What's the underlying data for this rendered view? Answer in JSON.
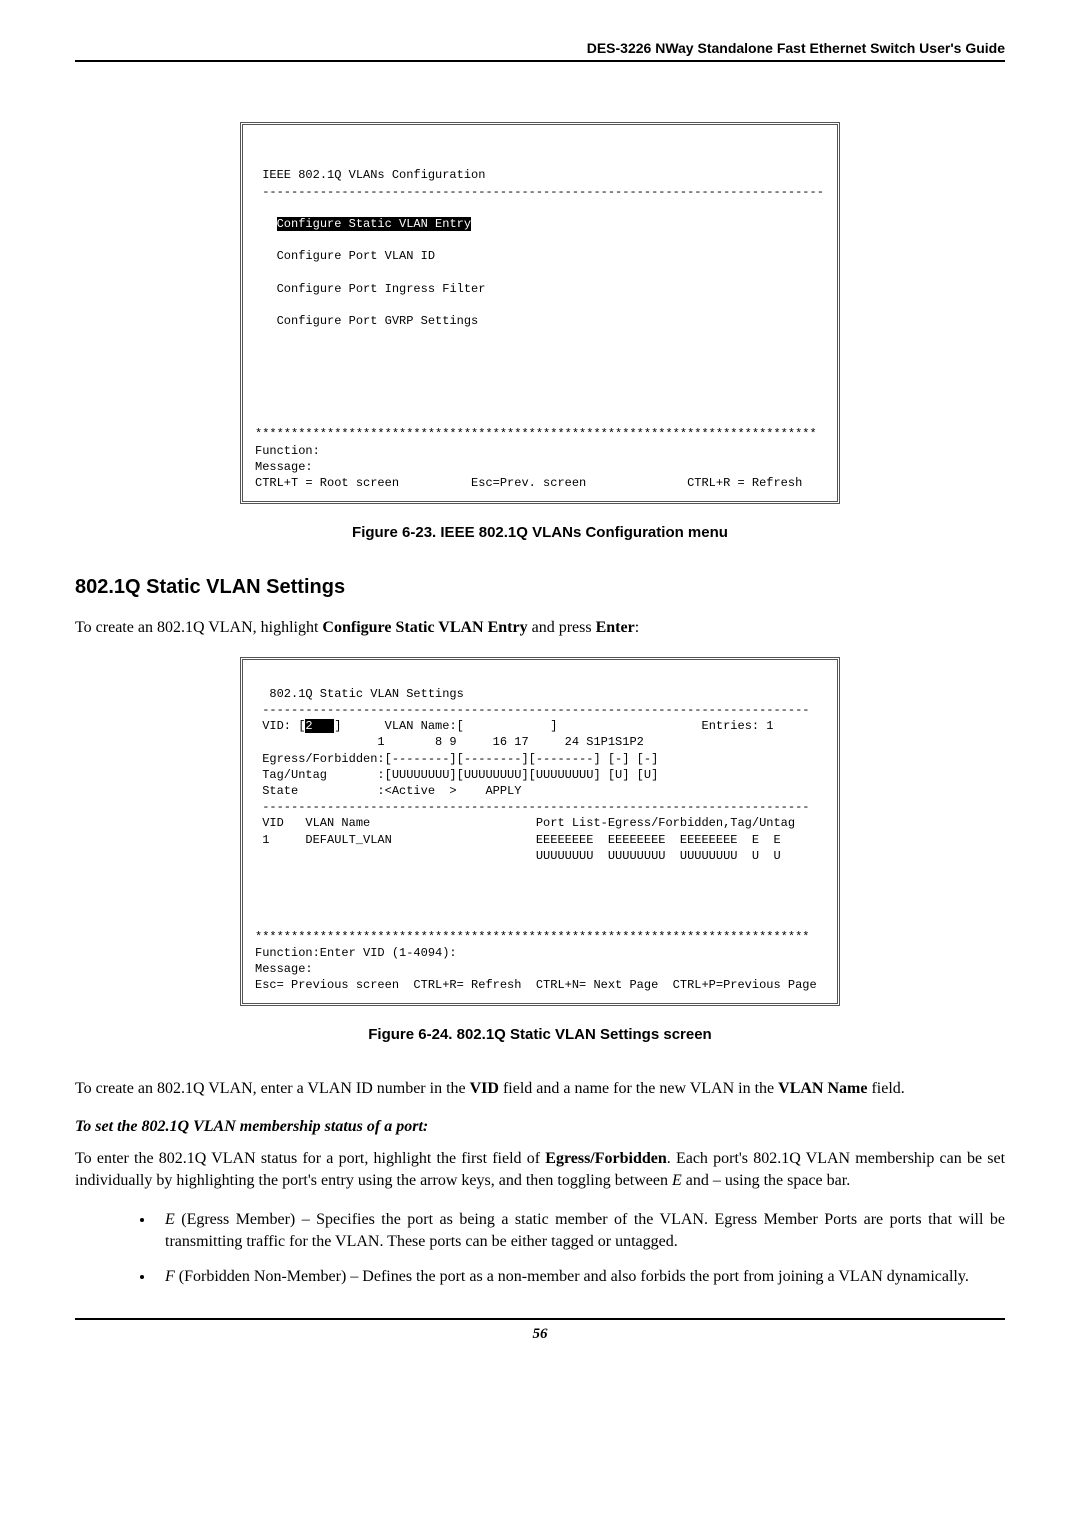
{
  "header": "DES-3226 NWay Standalone Fast Ethernet Switch User's Guide",
  "term1": {
    "title": "IEEE 802.1Q VLANs Configuration",
    "rule": "------------------------------------------------------------------------------",
    "menu_highlight": "Configure Static VLAN Entry",
    "menu2": "Configure Port VLAN ID",
    "menu3": "Configure Port Ingress Filter",
    "menu4": "Configure Port GVRP Settings",
    "stars": "******************************************************************************",
    "func": "Function:",
    "msg": "Message:",
    "footer": "CTRL+T = Root screen          Esc=Prev. screen              CTRL+R = Refresh"
  },
  "cap1": "Figure 6-23.  IEEE 802.1Q VLANs Configuration menu",
  "sect_head": "802.1Q Static VLAN Settings",
  "para1_a": "To create an 802.1Q VLAN, highlight ",
  "para1_b": "Configure Static VLAN Entry",
  "para1_c": " and press ",
  "para1_d": "Enter",
  "para1_e": ":",
  "term2": {
    "title": "  802.1Q Static VLAN Settings",
    "rule": " ----------------------------------------------------------------------------",
    "l1a": " VID: [",
    "l1inv": "2   ",
    "l1b": "]      VLAN Name:[            ]                    Entries: 1",
    "l2": "                 1       8 9     16 17     24 S1P1S1P2",
    "l3": " Egress/Forbidden:[--------][--------][--------] [-] [-]",
    "l4": " Tag/Untag       :[UUUUUUUU][UUUUUUUU][UUUUUUUU] [U] [U]",
    "l5": " State           :<Active  >    APPLY",
    "rule2": " ----------------------------------------------------------------------------",
    "l6": " VID   VLAN Name                       Port List-Egress/Forbidden,Tag/Untag",
    "l7": " 1     DEFAULT_VLAN                    EEEEEEEE  EEEEEEEE  EEEEEEEE  E  E",
    "l8": "                                       UUUUUUUU  UUUUUUUU  UUUUUUUU  U  U",
    "stars": "*****************************************************************************",
    "func": "Function:Enter VID (1-4094):",
    "msg": "Message:",
    "footer": "Esc= Previous screen  CTRL+R= Refresh  CTRL+N= Next Page  CTRL+P=Previous Page"
  },
  "cap2": "Figure 6-24.  802.1Q Static VLAN Settings screen",
  "para2_a": "To create an 802.1Q VLAN, enter a VLAN ID number in the ",
  "para2_b": "VID",
  "para2_c": " field and a name for the new VLAN in the ",
  "para2_d": "VLAN Name",
  "para2_e": " field.",
  "subhead": "To set the 802.1Q VLAN membership status of a port:",
  "para3_a": "To enter the 802.1Q VLAN status for a port, highlight the first field of ",
  "para3_b": "Egress/Forbidden",
  "para3_c": ". Each port's 802.1Q VLAN membership can be set individually by highlighting the port's entry using the arrow keys, and then toggling between ",
  "para3_d": "E",
  "para3_e": " and – using the space bar.",
  "b1_a": "E",
  "b1_b": " (Egress Member) – Specifies the port as being a static member of the VLAN. Egress Member Ports are ports that will be transmitting traffic for the VLAN. These ports can be either tagged or untagged.",
  "b2_a": "F",
  "b2_b": " (Forbidden Non-Member) – Defines the port as a non-member and also forbids the port from joining a VLAN dynamically.",
  "pagenum": "56"
}
